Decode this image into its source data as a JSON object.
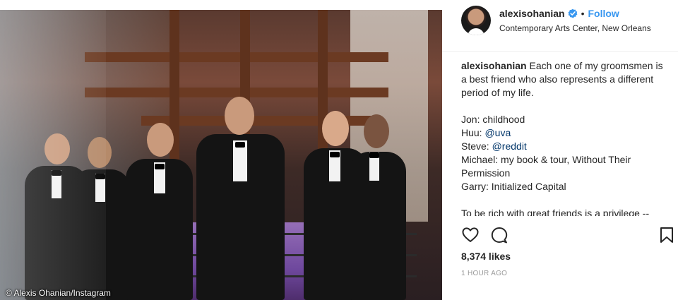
{
  "photo": {
    "credit": "© Alexis Ohanian/Instagram"
  },
  "post": {
    "username": "alexisohanian",
    "follow_label": "Follow",
    "separator": "•",
    "location": "Contemporary Arts Center, New Orleans",
    "caption_user": "alexisohanian",
    "caption_intro": "Each one of my groomsmen is a best friend who also represents a different period of my life.",
    "lines": [
      {
        "label": "Jon: ",
        "text": "childhood",
        "is_link": false
      },
      {
        "label": "Huu: ",
        "text": "@uva",
        "is_link": true
      },
      {
        "label": "Steve: ",
        "text": "@reddit",
        "is_link": true
      },
      {
        "label": "Michael: ",
        "text": "my book & tour, Without Their Permission",
        "is_link": false
      },
      {
        "label": "Garry: ",
        "text": "Initialized Capital",
        "is_link": false
      }
    ],
    "closing": "To be rich with great friends is a privilege --",
    "likes": "8,374 likes",
    "time": "1 HOUR AGO"
  },
  "icons": [
    "heart-icon",
    "comment-icon",
    "bookmark-icon",
    "verified-badge-icon"
  ],
  "colors": {
    "follow": "#3897f0",
    "verified": "#3897f0",
    "link": "#003569",
    "time": "#999999"
  }
}
